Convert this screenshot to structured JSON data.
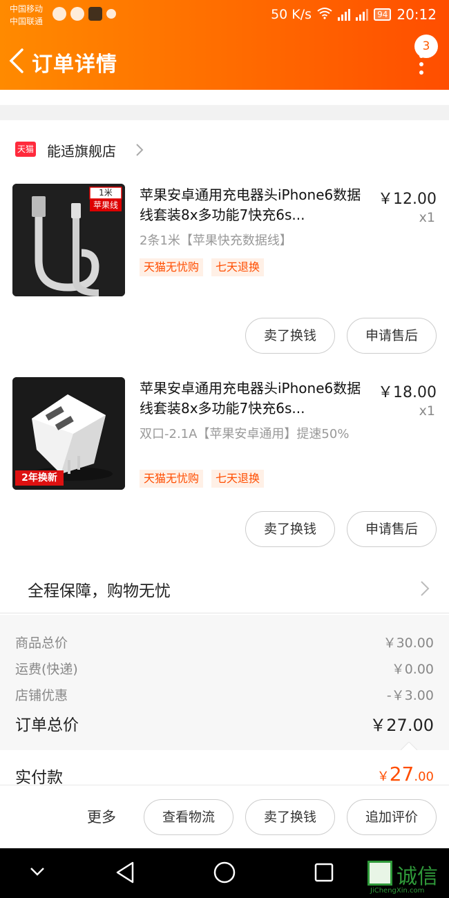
{
  "status_bar": {
    "carrier_1": "中国移动",
    "carrier_2": "中国联通",
    "net_speed": "50 K/s",
    "signal_1": "2G",
    "signal_2": "4G",
    "battery": "94",
    "time": "20:12"
  },
  "header": {
    "title": "订单详情",
    "message_count": "3"
  },
  "store": {
    "badge": "天猫",
    "name": "能适旗舰店"
  },
  "products": [
    {
      "name": "苹果安卓通用充电器头iPhone6数据线套装8x多功能7快充6s...",
      "price": "￥12.00",
      "quantity": "x1",
      "sku": "2条1米【苹果快充数据线】",
      "thumb_label_1": "1米",
      "thumb_label_2": "苹果线",
      "tags": [
        "天猫无忧购",
        "七天退换"
      ],
      "buttons": [
        "卖了换钱",
        "申请售后"
      ]
    },
    {
      "name": "苹果安卓通用充电器头iPhone6数据线套装8x多功能7快充6s...",
      "price": "￥18.00",
      "quantity": "x1",
      "sku": "双口-2.1A【苹果安卓通用】提速50%",
      "thumb_label_1": "2年换新",
      "tags": [
        "天猫无忧购",
        "七天退换"
      ],
      "buttons": [
        "卖了换钱",
        "申请售后"
      ]
    }
  ],
  "guarantee": {
    "text": "全程保障，购物无忧"
  },
  "summary": {
    "goods_total_label": "商品总价",
    "goods_total": "￥30.00",
    "shipping_label": "运费(快递)",
    "shipping": "￥0.00",
    "discount_label": "店铺优惠",
    "discount": "-￥3.00",
    "order_total_label": "订单总价",
    "order_total": "￥27.00"
  },
  "paid": {
    "label": "实付款",
    "currency": "￥",
    "integer": "27",
    "decimal": ".00"
  },
  "actions": {
    "more": "更多",
    "track": "查看物流",
    "sell": "卖了换钱",
    "review": "追加评价"
  },
  "watermark": {
    "text": "诚信",
    "sub": "JiChengXin.com"
  },
  "colors": {
    "accent": "#ff5b00",
    "tmall_red": "#ff2a3c",
    "tag_orange": "#ff4d00"
  }
}
